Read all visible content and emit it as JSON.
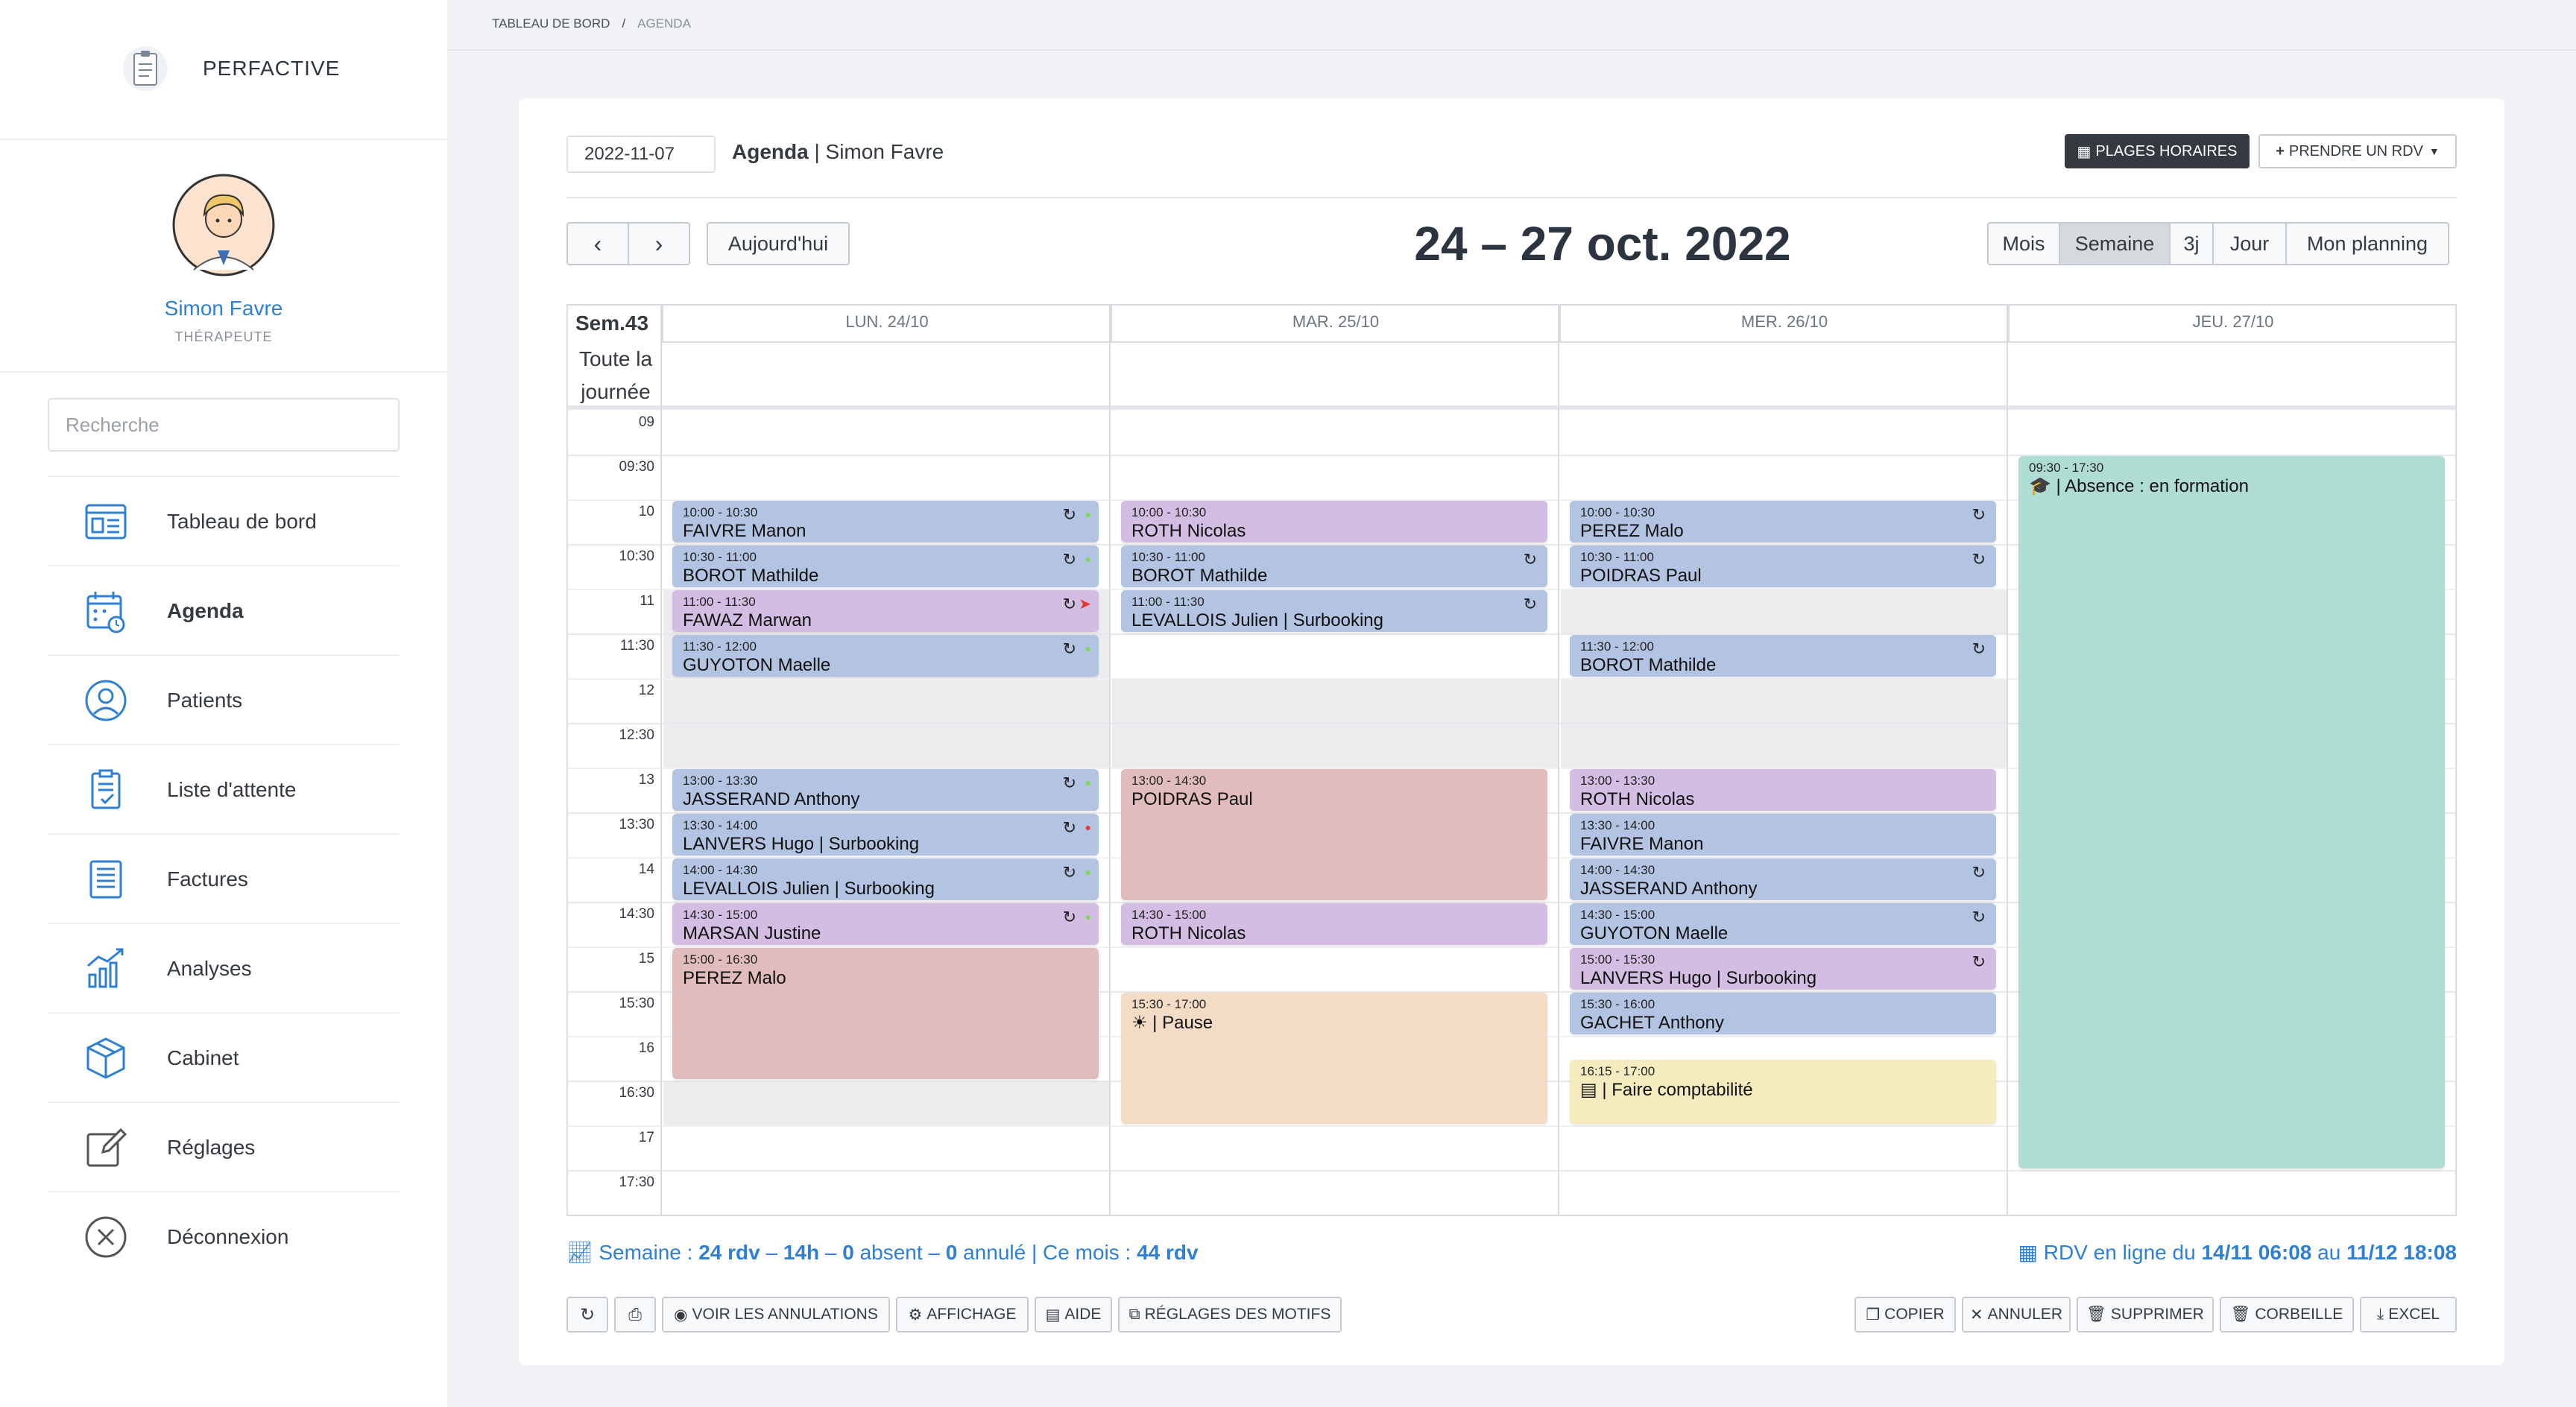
{
  "app": {
    "brand": "PERFACTIVE"
  },
  "user": {
    "name": "Simon Favre",
    "role": "THÉRAPEUTE"
  },
  "search": {
    "placeholder": "Recherche"
  },
  "nav": [
    {
      "label": "Tableau de bord",
      "icon": "dashboard-icon"
    },
    {
      "label": "Agenda",
      "icon": "calendar-icon",
      "active": true
    },
    {
      "label": "Patients",
      "icon": "user-circle-icon"
    },
    {
      "label": "Liste d'attente",
      "icon": "clipboard-check-icon"
    },
    {
      "label": "Factures",
      "icon": "invoice-icon"
    },
    {
      "label": "Analyses",
      "icon": "chart-icon"
    },
    {
      "label": "Cabinet",
      "icon": "box-icon"
    },
    {
      "label": "Réglages",
      "icon": "edit-icon"
    },
    {
      "label": "Déconnexion",
      "icon": "logout-icon"
    }
  ],
  "breadcrumb": {
    "home": "TABLEAU DE BORD",
    "sep": "/",
    "current": "AGENDA"
  },
  "toolbar": {
    "date_value": "2022-11-07",
    "title_bold": "Agenda",
    "title_rest": " | Simon Favre",
    "plages_label": "PLAGES HORAIRES",
    "rdv_label": "PRENDRE UN RDV",
    "today_label": "Aujourd'hui",
    "range": "24 – 27 oct. 2022",
    "views": [
      "Mois",
      "Semaine",
      "3j",
      "Jour",
      "Mon planning"
    ],
    "active_view": "Semaine"
  },
  "calendar": {
    "week_label": "Sem.43",
    "allday_label": "Toute la journée",
    "days": [
      "LUN. 24/10",
      "MAR. 25/10",
      "MER. 26/10",
      "JEU. 27/10"
    ],
    "times": [
      "09",
      "09:30",
      "10",
      "10:30",
      "11",
      "11:30",
      "12",
      "12:30",
      "13",
      "13:30",
      "14",
      "14:30",
      "15",
      "15:30",
      "16",
      "16:30",
      "17",
      "17:30"
    ],
    "events": [
      {
        "day": 0,
        "start": "10:00",
        "end": "10:30",
        "time": "10:00 - 10:30",
        "name": "FAIVRE Manon",
        "color": "blue",
        "icons": "↻ ●",
        "dot": "#7ed957"
      },
      {
        "day": 0,
        "start": "10:30",
        "end": "11:00",
        "time": "10:30 - 11:00",
        "name": "BOROT Mathilde",
        "color": "blue",
        "icons": "↻ ●",
        "dot": "#7ed957"
      },
      {
        "day": 0,
        "start": "11:00",
        "end": "11:30",
        "time": "11:00 - 11:30",
        "name": "FAWAZ Marwan",
        "color": "purp",
        "icons": "↻ ➤",
        "dot": "#e53935"
      },
      {
        "day": 0,
        "start": "11:30",
        "end": "12:00",
        "time": "11:30 - 12:00",
        "name": "GUYOTON Maelle",
        "color": "blue",
        "icons": "↻ ●",
        "dot": "#7ed957"
      },
      {
        "day": 0,
        "start": "13:00",
        "end": "13:30",
        "time": "13:00 - 13:30",
        "name": "JASSERAND Anthony",
        "color": "blue",
        "icons": "↻ ●",
        "dot": "#7ed957"
      },
      {
        "day": 0,
        "start": "13:30",
        "end": "14:00",
        "time": "13:30 - 14:00",
        "name": "LANVERS Hugo | Surbooking",
        "color": "blue",
        "icons": "↻ ●",
        "dot": "#e53935"
      },
      {
        "day": 0,
        "start": "14:00",
        "end": "14:30",
        "time": "14:00 - 14:30",
        "name": "LEVALLOIS Julien | Surbooking",
        "color": "blue",
        "icons": "↻ ●",
        "dot": "#7ed957"
      },
      {
        "day": 0,
        "start": "14:30",
        "end": "15:00",
        "time": "14:30 - 15:00",
        "name": "MARSAN Justine",
        "color": "purp",
        "icons": "↻ ●",
        "dot": "#7ed957"
      },
      {
        "day": 0,
        "start": "15:00",
        "end": "16:30",
        "time": "15:00 - 16:30",
        "name": "PEREZ Malo",
        "color": "red",
        "icons": ""
      },
      {
        "day": 1,
        "start": "10:00",
        "end": "10:30",
        "time": "10:00 - 10:30",
        "name": "ROTH Nicolas",
        "color": "purp",
        "icons": ""
      },
      {
        "day": 1,
        "start": "10:30",
        "end": "11:00",
        "time": "10:30 - 11:00",
        "name": "BOROT Mathilde",
        "color": "blue",
        "icons": "↻"
      },
      {
        "day": 1,
        "start": "11:00",
        "end": "11:30",
        "time": "11:00 - 11:30",
        "name": "LEVALLOIS Julien | Surbooking",
        "color": "blue",
        "icons": "↻"
      },
      {
        "day": 1,
        "start": "13:00",
        "end": "14:30",
        "time": "13:00 - 14:30",
        "name": "POIDRAS Paul",
        "color": "red",
        "icons": ""
      },
      {
        "day": 1,
        "start": "14:30",
        "end": "15:00",
        "time": "14:30 - 15:00",
        "name": "ROTH Nicolas",
        "color": "purp",
        "icons": ""
      },
      {
        "day": 1,
        "start": "15:30",
        "end": "17:00",
        "time": "15:30 - 17:00",
        "name": "☀ | Pause",
        "color": "peach",
        "icons": ""
      },
      {
        "day": 2,
        "start": "10:00",
        "end": "10:30",
        "time": "10:00 - 10:30",
        "name": "PEREZ Malo",
        "color": "blue",
        "icons": "↻"
      },
      {
        "day": 2,
        "start": "10:30",
        "end": "11:00",
        "time": "10:30 - 11:00",
        "name": "POIDRAS Paul",
        "color": "blue",
        "icons": "↻"
      },
      {
        "day": 2,
        "start": "11:30",
        "end": "12:00",
        "time": "11:30 - 12:00",
        "name": "BOROT Mathilde",
        "color": "blue",
        "icons": "↻"
      },
      {
        "day": 2,
        "start": "13:00",
        "end": "13:30",
        "time": "13:00 - 13:30",
        "name": "ROTH Nicolas",
        "color": "purp",
        "icons": ""
      },
      {
        "day": 2,
        "start": "13:30",
        "end": "14:00",
        "time": "13:30 - 14:00",
        "name": "FAIVRE Manon",
        "color": "blue",
        "icons": ""
      },
      {
        "day": 2,
        "start": "14:00",
        "end": "14:30",
        "time": "14:00 - 14:30",
        "name": "JASSERAND Anthony",
        "color": "blue",
        "icons": "↻"
      },
      {
        "day": 2,
        "start": "14:30",
        "end": "15:00",
        "time": "14:30 - 15:00",
        "name": "GUYOTON Maelle",
        "color": "blue",
        "icons": "↻"
      },
      {
        "day": 2,
        "start": "15:00",
        "end": "15:30",
        "time": "15:00 - 15:30",
        "name": "LANVERS Hugo | Surbooking",
        "color": "purp",
        "icons": "↻"
      },
      {
        "day": 2,
        "start": "15:30",
        "end": "16:00",
        "time": "15:30 - 16:00",
        "name": "GACHET Anthony",
        "color": "blue",
        "icons": ""
      },
      {
        "day": 2,
        "start": "16:15",
        "end": "17:00",
        "time": "16:15 - 17:00",
        "name": "▤ | Faire comptabilité",
        "color": "yell",
        "icons": ""
      },
      {
        "day": 3,
        "start": "09:30",
        "end": "17:30",
        "time": "09:30 - 17:30",
        "name": "🎓 | Absence : en formation",
        "color": "teal",
        "icons": ""
      }
    ]
  },
  "stats": {
    "prefix": "Semaine : ",
    "rdv": "24 rdv",
    "dash1": " – ",
    "hours": "14h",
    "dash2": " – ",
    "absent": "0",
    "absent_txt": " absent – ",
    "annule": "0",
    "annule_txt": " annulé | Ce mois : ",
    "month": "44 rdv"
  },
  "online": {
    "prefix": "RDV en ligne du ",
    "from": "14/11 06:08",
    "mid": " au ",
    "to": "11/12 18:08"
  },
  "footer_left": [
    "VOIR LES ANNULATIONS",
    "AFFICHAGE",
    "AIDE",
    "RÉGLAGES DES MOTIFS"
  ],
  "footer_right": [
    "COPIER",
    "ANNULER",
    "SUPPRIMER",
    "CORBEILLE",
    "EXCEL"
  ],
  "colors": {
    "accent": "#2f7fd3",
    "blue": "#b3c3e2",
    "purple": "#d3bde2",
    "red": "#e1bcbc",
    "teal": "#b0ddd3"
  }
}
